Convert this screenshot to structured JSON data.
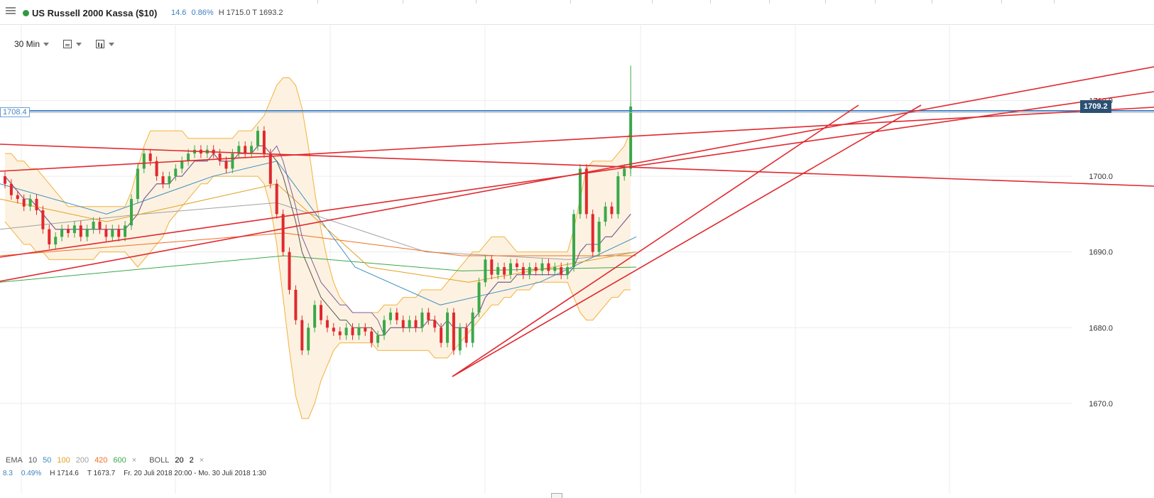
{
  "header": {
    "title": "US Russell 2000 Kassa ($10)",
    "change": "14.6",
    "change_pct": "0.86%",
    "high": "H 1715.0",
    "low": "T 1693.2",
    "status_color": "#2e9b3e"
  },
  "toolbar": {
    "timeframe": "30 Min"
  },
  "price_tags": {
    "left": "1708.4",
    "right": "1709.2"
  },
  "indicator_bar": {
    "ema_label": "EMA",
    "ema_periods": [
      {
        "value": "10",
        "color": "#555555"
      },
      {
        "value": "50",
        "color": "#3d8fc1"
      },
      {
        "value": "100",
        "color": "#e3a020"
      },
      {
        "value": "200",
        "color": "#a0a0a0"
      },
      {
        "value": "420",
        "color": "#f26d21"
      },
      {
        "value": "600",
        "color": "#3aa84a"
      }
    ],
    "boll_label": "BOLL",
    "boll_period": "20",
    "boll_dev": "2",
    "remove_symbol": "×"
  },
  "info_bar": {
    "change": "8.3",
    "change_pct": "0.49%",
    "high": "H 1714.6",
    "low": "T 1673.7",
    "range": "Fr. 20 Juli 2018 20:00 - Mo. 30 Juli 2018 1:30"
  },
  "chart_data": {
    "type": "candlestick",
    "y_ticks": [
      1670.0,
      1680.0,
      1690.0,
      1700.0,
      1710.0
    ],
    "y_tick_labels": [
      "1670.0",
      "1680.0",
      "1690.0",
      "1700.0",
      "1710.0"
    ],
    "ylim": [
      1662.0,
      1718.0
    ],
    "grid": true,
    "colors": {
      "up": "#3aa84a",
      "down": "#e0282e",
      "trendline": "#e0282e",
      "hline": "#4a86c5",
      "boll_fill": "#fdf2e1",
      "boll_line": "#f2b13a"
    },
    "horizontal_lines": [
      1708.4,
      1709.2
    ],
    "key_prices": [
      1670.0,
      1673.7,
      1680.0,
      1690.0,
      1700.0,
      1709.2,
      1714.6
    ],
    "candles": [
      [
        1700.0,
        1699.0
      ],
      [
        1699.0,
        1697.5
      ],
      [
        1697.5,
        1697.0
      ],
      [
        1697.0,
        1696.0
      ],
      [
        1696.0,
        1697.0
      ],
      [
        1697.0,
        1695.5
      ],
      [
        1695.5,
        1693.0
      ],
      [
        1693.0,
        1691.0
      ],
      [
        1691.0,
        1692.0
      ],
      [
        1692.0,
        1693.0
      ],
      [
        1693.0,
        1692.5
      ],
      [
        1692.5,
        1693.5
      ],
      [
        1693.5,
        1692.0
      ],
      [
        1692.0,
        1693.0
      ],
      [
        1693.0,
        1694.0
      ],
      [
        1694.0,
        1693.0
      ],
      [
        1693.0,
        1692.0
      ],
      [
        1692.0,
        1693.0
      ],
      [
        1693.0,
        1692.0
      ],
      [
        1692.0,
        1693.5
      ],
      [
        1693.5,
        1697.0
      ],
      [
        1697.0,
        1701.0
      ],
      [
        1701.0,
        1703.0
      ],
      [
        1703.0,
        1702.0
      ],
      [
        1702.0,
        1700.0
      ],
      [
        1700.0,
        1699.0
      ],
      [
        1699.0,
        1700.0
      ],
      [
        1700.0,
        1701.0
      ],
      [
        1701.0,
        1702.0
      ],
      [
        1702.0,
        1703.0
      ],
      [
        1703.0,
        1703.5
      ],
      [
        1703.5,
        1703.0
      ],
      [
        1703.0,
        1703.5
      ],
      [
        1703.5,
        1703.0
      ],
      [
        1703.0,
        1702.0
      ],
      [
        1702.0,
        1701.0
      ],
      [
        1701.0,
        1703.0
      ],
      [
        1703.0,
        1704.0
      ],
      [
        1704.0,
        1703.0
      ],
      [
        1703.0,
        1704.0
      ],
      [
        1704.0,
        1706.0
      ],
      [
        1706.0,
        1703.0
      ],
      [
        1703.0,
        1699.0
      ],
      [
        1699.0,
        1695.0
      ],
      [
        1695.0,
        1690.0
      ],
      [
        1690.0,
        1685.0
      ],
      [
        1685.0,
        1681.0
      ],
      [
        1681.0,
        1677.0
      ],
      [
        1677.0,
        1680.0
      ],
      [
        1680.0,
        1683.0
      ],
      [
        1683.0,
        1681.0
      ],
      [
        1681.0,
        1680.0
      ],
      [
        1680.0,
        1679.5
      ],
      [
        1679.5,
        1679.0
      ],
      [
        1679.0,
        1680.0
      ],
      [
        1680.0,
        1679.0
      ],
      [
        1679.0,
        1680.0
      ],
      [
        1680.0,
        1679.5
      ],
      [
        1679.5,
        1678.0
      ],
      [
        1678.0,
        1679.0
      ],
      [
        1679.0,
        1681.0
      ],
      [
        1681.0,
        1682.0
      ],
      [
        1682.0,
        1681.0
      ],
      [
        1681.0,
        1680.0
      ],
      [
        1680.0,
        1681.0
      ],
      [
        1681.0,
        1680.0
      ],
      [
        1680.0,
        1682.0
      ],
      [
        1682.0,
        1681.0
      ],
      [
        1681.0,
        1680.0
      ],
      [
        1680.0,
        1678.0
      ],
      [
        1678.0,
        1682.0
      ],
      [
        1682.0,
        1677.0
      ],
      [
        1677.0,
        1680.0
      ],
      [
        1680.0,
        1678.0
      ],
      [
        1678.0,
        1682.0
      ],
      [
        1682.0,
        1686.0
      ],
      [
        1686.0,
        1689.0
      ],
      [
        1689.0,
        1687.0
      ],
      [
        1687.0,
        1688.0
      ],
      [
        1688.0,
        1687.0
      ],
      [
        1687.0,
        1688.5
      ],
      [
        1688.5,
        1688.0
      ],
      [
        1688.0,
        1687.0
      ],
      [
        1687.0,
        1688.0
      ],
      [
        1688.0,
        1687.5
      ],
      [
        1687.5,
        1688.5
      ],
      [
        1688.5,
        1687.5
      ],
      [
        1687.5,
        1688.0
      ],
      [
        1688.0,
        1687.0
      ],
      [
        1687.0,
        1688.0
      ],
      [
        1688.0,
        1695.0
      ],
      [
        1695.0,
        1701.0
      ],
      [
        1701.0,
        1695.0
      ],
      [
        1695.0,
        1690.0
      ],
      [
        1690.0,
        1694.0
      ],
      [
        1694.0,
        1696.0
      ],
      [
        1696.0,
        1695.0
      ],
      [
        1695.0,
        1700.0
      ],
      [
        1700.0,
        1701.0
      ],
      [
        1701.0,
        1709.2
      ]
    ],
    "ema10": [
      1700,
      1699,
      1698,
      1697,
      1697,
      1696,
      1695,
      1694,
      1693,
      1693,
      1693,
      1693,
      1693,
      1693,
      1693,
      1693,
      1693,
      1693,
      1693,
      1693,
      1694,
      1695,
      1697,
      1698,
      1699,
      1699,
      1699,
      1700,
      1700,
      1701,
      1702,
      1702,
      1702,
      1703,
      1702,
      1702,
      1702,
      1703,
      1703,
      1703,
      1704,
      1704,
      1703,
      1702,
      1700,
      1697,
      1694,
      1690,
      1688,
      1686,
      1684,
      1683,
      1682,
      1681,
      1681,
      1680,
      1680,
      1680,
      1680,
      1679,
      1679,
      1680,
      1680,
      1680,
      1680,
      1680,
      1680,
      1681,
      1681,
      1680,
      1681,
      1680,
      1680,
      1680,
      1681,
      1682,
      1684,
      1685,
      1686,
      1686,
      1686,
      1687,
      1687,
      1687,
      1687,
      1687,
      1687,
      1687,
      1687,
      1687,
      1688,
      1690,
      1691,
      1691,
      1691,
      1692,
      1692,
      1693,
      1694,
      1695
    ],
    "boll_upper": [
      1703,
      1703,
      1702,
      1702,
      1701,
      1701,
      1700,
      1699,
      1698,
      1697,
      1696,
      1696,
      1696,
      1696,
      1696,
      1696,
      1696,
      1696,
      1696,
      1696,
      1698,
      1701,
      1704,
      1706,
      1706,
      1706,
      1706,
      1706,
      1706,
      1705,
      1705,
      1705,
      1705,
      1705,
      1705,
      1705,
      1705,
      1706,
      1706,
      1706,
      1707,
      1708,
      1710,
      1712,
      1713,
      1713,
      1712,
      1709,
      1704,
      1698,
      1693,
      1689,
      1686,
      1684,
      1683,
      1682,
      1682,
      1682,
      1682,
      1682,
      1683,
      1683,
      1683,
      1684,
      1684,
      1684,
      1685,
      1685,
      1685,
      1685,
      1686,
      1687,
      1688,
      1689,
      1690,
      1690,
      1691,
      1692,
      1692,
      1692,
      1691,
      1690,
      1690,
      1690,
      1690,
      1690,
      1690,
      1690,
      1690,
      1690,
      1693,
      1697,
      1701,
      1702,
      1702,
      1702,
      1702,
      1703,
      1704,
      1706
    ],
    "boll_lower": [
      1694,
      1693,
      1692,
      1691,
      1691,
      1690,
      1690,
      1689,
      1689,
      1689,
      1689,
      1689,
      1689,
      1689,
      1689,
      1690,
      1690,
      1690,
      1690,
      1690,
      1689,
      1688,
      1689,
      1690,
      1691,
      1692,
      1694,
      1695,
      1696,
      1697,
      1698,
      1699,
      1699,
      1700,
      1700,
      1700,
      1700,
      1700,
      1700,
      1700,
      1700,
      1699,
      1696,
      1691,
      1684,
      1677,
      1671,
      1668,
      1668,
      1670,
      1673,
      1675,
      1677,
      1678,
      1678,
      1678,
      1678,
      1678,
      1678,
      1677,
      1677,
      1677,
      1677,
      1677,
      1677,
      1677,
      1677,
      1677,
      1676,
      1676,
      1676,
      1677,
      1678,
      1679,
      1680,
      1681,
      1682,
      1683,
      1683,
      1684,
      1684,
      1685,
      1685,
      1685,
      1686,
      1686,
      1686,
      1686,
      1686,
      1686,
      1684,
      1682,
      1681,
      1681,
      1682,
      1683,
      1684,
      1684,
      1685,
      1685
    ]
  }
}
